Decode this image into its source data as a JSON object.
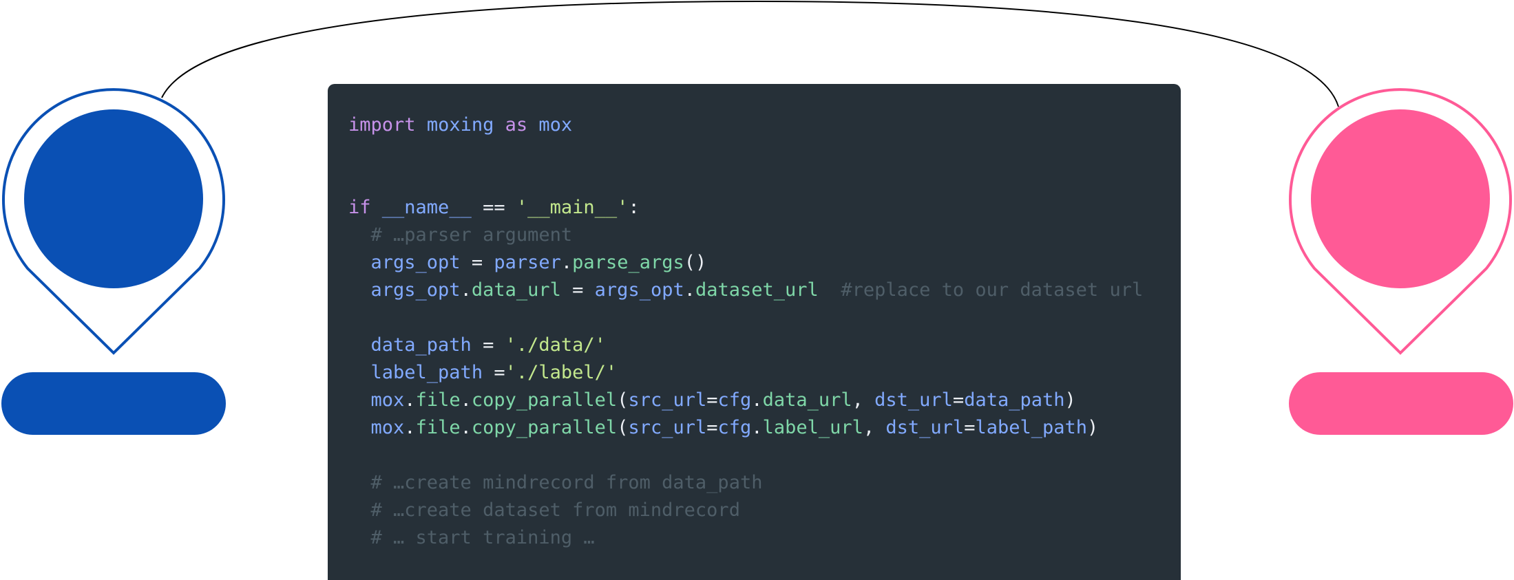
{
  "colors": {
    "left_pin": "#0a50b4",
    "right_pin": "#ff5a96",
    "code_bg": "#263038",
    "connector": "#000000"
  },
  "code": {
    "line1": {
      "kw_import": "import",
      "mod": "moxing",
      "kw_as": "as",
      "alias": "mox"
    },
    "line2": {
      "kw_if": "if",
      "name_var": "__name__",
      "eq": "==",
      "main_str": "'__main__'",
      "colon": ":"
    },
    "line3": {
      "comment": "# …parser argument"
    },
    "line4": {
      "var": "args_opt",
      "eq": "=",
      "obj": "parser",
      "fn": "parse_args",
      "parens": "()"
    },
    "line5": {
      "var": "args_opt",
      "attr": "data_url",
      "eq": "=",
      "rhs_var": "args_opt",
      "rhs_attr": "dataset_url",
      "comment": "#replace to our dataset url"
    },
    "line6": {
      "var": "data_path",
      "eq": "=",
      "str": "'./data/'"
    },
    "line7": {
      "var": "label_path",
      "eq": "=",
      "str": "'./label/'"
    },
    "line8": {
      "obj": "mox",
      "attr": "file",
      "fn": "copy_parallel",
      "p1": "src_url",
      "cfg": "cfg",
      "cfg_attr": "data_url",
      "p2": "dst_url",
      "val": "data_path"
    },
    "line9": {
      "obj": "mox",
      "attr": "file",
      "fn": "copy_parallel",
      "p1": "src_url",
      "cfg": "cfg",
      "cfg_attr": "label_url",
      "p2": "dst_url",
      "val": "label_path"
    },
    "line10": {
      "comment": "# …create mindrecord from data_path"
    },
    "line11": {
      "comment": "# …create dataset from mindrecord"
    },
    "line12": {
      "comment": "# … start training …"
    }
  }
}
